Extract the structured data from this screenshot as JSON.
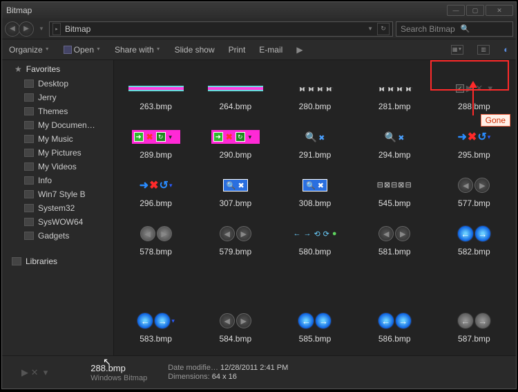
{
  "window": {
    "title": "Bitmap"
  },
  "address": {
    "path": "Bitmap"
  },
  "search": {
    "placeholder": "Search Bitmap"
  },
  "toolbar": {
    "organize": "Organize",
    "open": "Open",
    "share": "Share with",
    "slideshow": "Slide show",
    "print": "Print",
    "email": "E-mail"
  },
  "sidebar": {
    "favorites_label": "Favorites",
    "items": [
      "Desktop",
      "Jerry",
      "Themes",
      "My Documen…",
      "My Music",
      "My Pictures",
      "My Videos",
      "Info",
      "Win7 Style B",
      "System32",
      "SysWOW64",
      "Gadgets"
    ],
    "libraries_label": "Libraries"
  },
  "files": [
    {
      "name": "263.bmp",
      "t": "strip"
    },
    {
      "name": "264.bmp",
      "t": "strip"
    },
    {
      "name": "280.bmp",
      "t": "beads"
    },
    {
      "name": "281.bmp",
      "t": "beads"
    },
    {
      "name": "288.bmp",
      "t": "faint-check"
    },
    {
      "name": "289.bmp",
      "t": "pinkbox"
    },
    {
      "name": "290.bmp",
      "t": "pinkbox"
    },
    {
      "name": "291.bmp",
      "t": "magx"
    },
    {
      "name": "294.bmp",
      "t": "magx"
    },
    {
      "name": "295.bmp",
      "t": "arrows"
    },
    {
      "name": "296.bmp",
      "t": "arrows"
    },
    {
      "name": "307.bmp",
      "t": "bluesq"
    },
    {
      "name": "308.bmp",
      "t": "bluesq"
    },
    {
      "name": "545.bmp",
      "t": "dash"
    },
    {
      "name": "577.bmp",
      "t": "round2"
    },
    {
      "name": "578.bmp",
      "t": "round2l"
    },
    {
      "name": "579.bmp",
      "t": "round2"
    },
    {
      "name": "580.bmp",
      "t": "tiny"
    },
    {
      "name": "581.bmp",
      "t": "round2"
    },
    {
      "name": "582.bmp",
      "t": "bluepair"
    },
    {
      "name": "583.bmp",
      "t": "bluepair-dd"
    },
    {
      "name": "584.bmp",
      "t": "round2"
    },
    {
      "name": "585.bmp",
      "t": "bluepair"
    },
    {
      "name": "586.bmp",
      "t": "bluepair"
    },
    {
      "name": "587.bmp",
      "t": "greypair"
    }
  ],
  "annotation": {
    "label": "Gone"
  },
  "status": {
    "filename": "288.bmp",
    "filetype": "Windows Bitmap",
    "modified_label": "Date modifie…",
    "modified_value": "12/28/2011 2:41 PM",
    "dim_label": "Dimensions:",
    "dim_value": "64 x 16"
  }
}
